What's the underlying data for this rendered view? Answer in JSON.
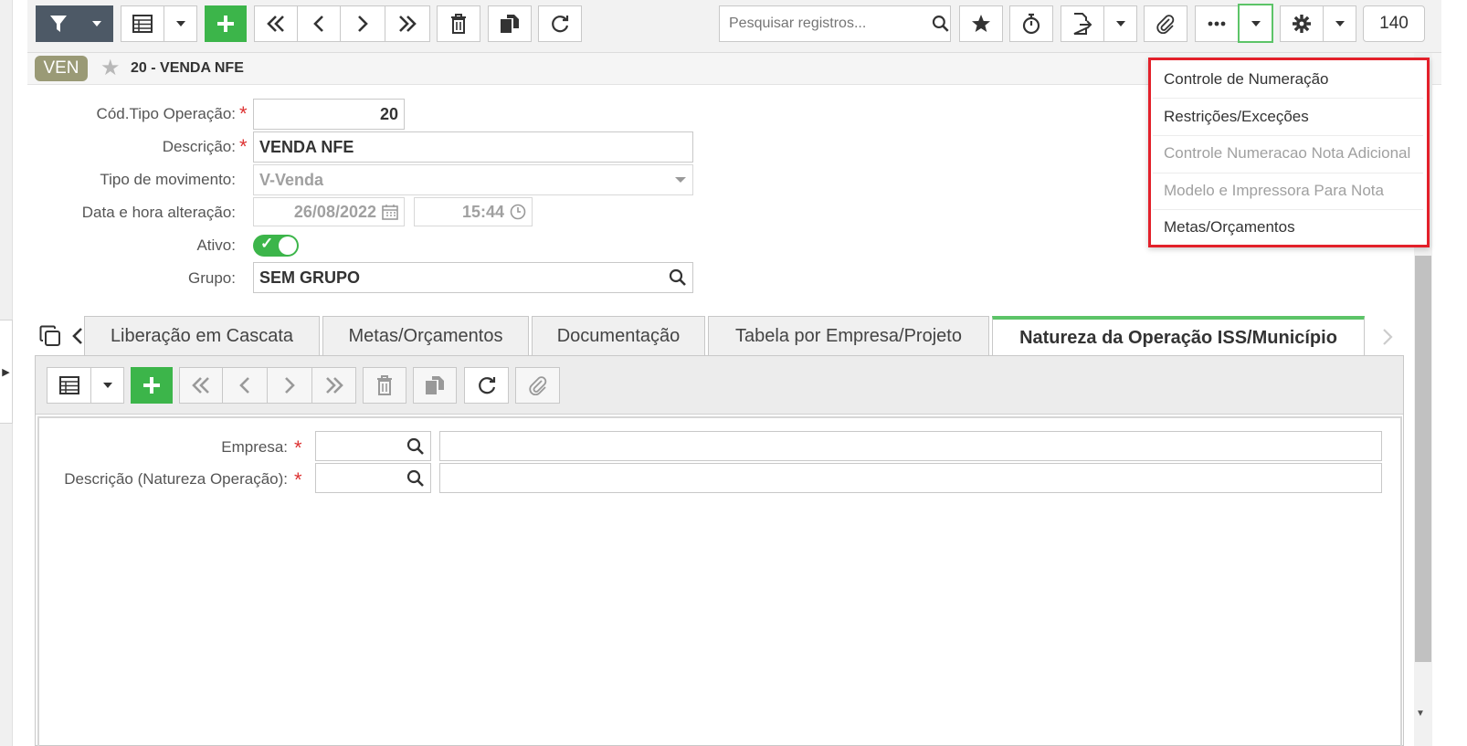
{
  "toolbar": {
    "search_placeholder": "Pesquisar registros...",
    "record_count": "140",
    "accent_green": "#3cb54a",
    "dark_button_color": "#4d5966"
  },
  "record": {
    "badge": "VEN",
    "title": "20 - VENDA NFE"
  },
  "form": {
    "cod_tipo_label": "Cód.Tipo Operação:",
    "cod_tipo_value": "20",
    "descricao_label": "Descrição:",
    "descricao_value": "VENDA NFE",
    "tipo_mov_label": "Tipo de movimento:",
    "tipo_mov_value": "V-Venda",
    "data_label": "Data e hora alteração:",
    "date_value": "26/08/2022",
    "time_value": "15:44",
    "ativo_label": "Ativo:",
    "grupo_label": "Grupo:",
    "grupo_value": "SEM GRUPO",
    "required_mark": "*"
  },
  "tabs": [
    {
      "label": "Liberação em Cascata"
    },
    {
      "label": "Metas/Orçamentos"
    },
    {
      "label": "Documentação"
    },
    {
      "label": "Tabela por Empresa/Projeto"
    },
    {
      "label": "Natureza da Operação ISS/Município",
      "active": true
    }
  ],
  "subform": {
    "empresa_label": "Empresa:",
    "natureza_label": "Descrição (Natureza Operação):"
  },
  "dropdown": {
    "items": [
      {
        "label": "Controle de Numeração",
        "enabled": true
      },
      {
        "label": "Restrições/Exceções",
        "enabled": true
      },
      {
        "label": "Controle Numeracao Nota Adicional",
        "enabled": false
      },
      {
        "label": "Modelo e Impressora Para Nota",
        "enabled": false
      },
      {
        "label": "Metas/Orçamentos",
        "enabled": true
      }
    ],
    "border_color": "#e3202a"
  }
}
